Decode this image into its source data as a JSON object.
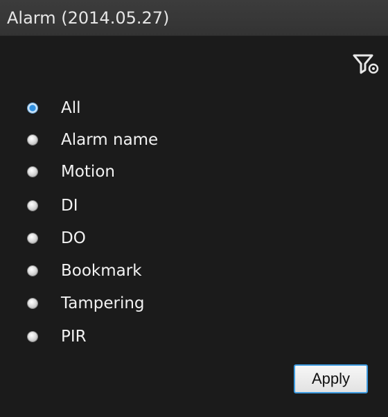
{
  "header": {
    "title": "Alarm (2014.05.27)"
  },
  "toolbar": {
    "filter_icon": "filter-icon"
  },
  "filter": {
    "selected": "All",
    "options": [
      {
        "label": "All",
        "checked": true
      },
      {
        "label": "Alarm name",
        "checked": false
      },
      {
        "label": "Motion",
        "checked": false
      },
      {
        "label": "DI",
        "checked": false
      },
      {
        "label": "DO",
        "checked": false
      },
      {
        "label": "Bookmark",
        "checked": false
      },
      {
        "label": "Tampering",
        "checked": false
      },
      {
        "label": "PIR",
        "checked": false
      }
    ]
  },
  "actions": {
    "apply_label": "Apply"
  },
  "colors": {
    "background": "#1b1b1b",
    "titlebar": "#383838",
    "text": "#f2f2f2",
    "accent": "#2f8fe0"
  }
}
